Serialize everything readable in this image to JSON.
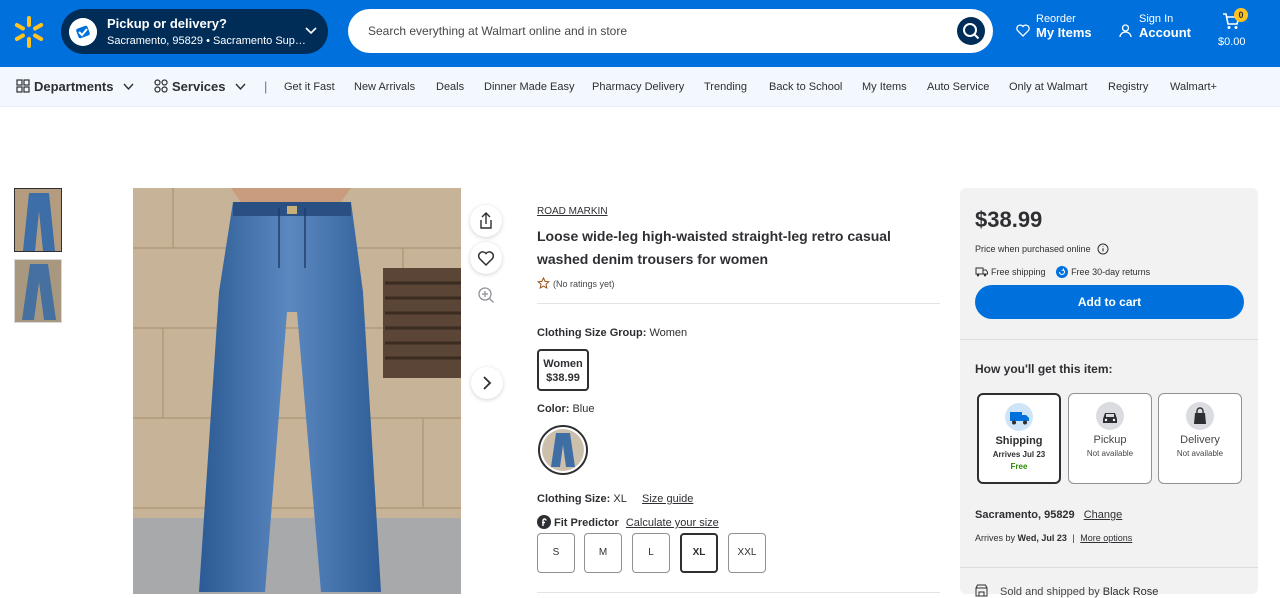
{
  "header": {
    "pickup_title": "Pickup or delivery?",
    "pickup_location": "Sacramento, 95829 • Sacramento Supe...",
    "search_placeholder": "Search everything at Walmart online and in store",
    "reorder_small": "Reorder",
    "reorder_big": "My Items",
    "signin_small": "Sign In",
    "signin_big": "Account",
    "cart_count": "0",
    "cart_total": "$0.00",
    "brand_color": "#0071dc",
    "accent_color": "#ffc220"
  },
  "nav": {
    "departments": "Departments",
    "services": "Services",
    "separator": "|",
    "links": [
      "Get it Fast",
      "New Arrivals",
      "Deals",
      "Dinner Made Easy",
      "Pharmacy Delivery",
      "Trending",
      "Back to School",
      "My Items",
      "Auto Service",
      "Only at Walmart",
      "Registry",
      "Walmart+"
    ]
  },
  "product": {
    "brand": "ROAD MARKIN",
    "title": "Loose wide-leg high-waisted straight-leg retro casual washed denim trousers for women",
    "rating_text": "(No ratings yet)",
    "size_group_label": "Clothing Size Group:",
    "size_group_value": "Women",
    "size_group_option_name": "Women",
    "size_group_option_price": "$38.99",
    "color_label": "Color:",
    "color_value": "Blue",
    "size_label": "Clothing Size:",
    "size_value": "XL",
    "size_guide": "Size guide",
    "fit_predictor": "Fit Predictor",
    "calc_size": "Calculate your size",
    "sizes": [
      "S",
      "M",
      "L",
      "XL",
      "XXL"
    ],
    "selected_size": "XL"
  },
  "buybox": {
    "price": "$38.99",
    "price_note": "Price when purchased online",
    "free_shipping": "Free shipping",
    "free_returns": "Free 30-day returns",
    "add_to_cart": "Add to cart",
    "how_get": "How you'll get this item:",
    "options": [
      {
        "title": "Shipping",
        "line1": "Arrives Jul 23",
        "line2": "Free"
      },
      {
        "title": "Pickup",
        "line1": "Not available",
        "line2": ""
      },
      {
        "title": "Delivery",
        "line1": "Not available",
        "line2": ""
      }
    ],
    "location": "Sacramento, 95829",
    "change": "Change",
    "arrives_prefix": "Arrives by",
    "arrives_date": "Wed, Jul 23",
    "arrives_sep": "|",
    "more_options": "More options",
    "sold_prefix": "Sold and shipped by",
    "seller": "Black Rose"
  }
}
